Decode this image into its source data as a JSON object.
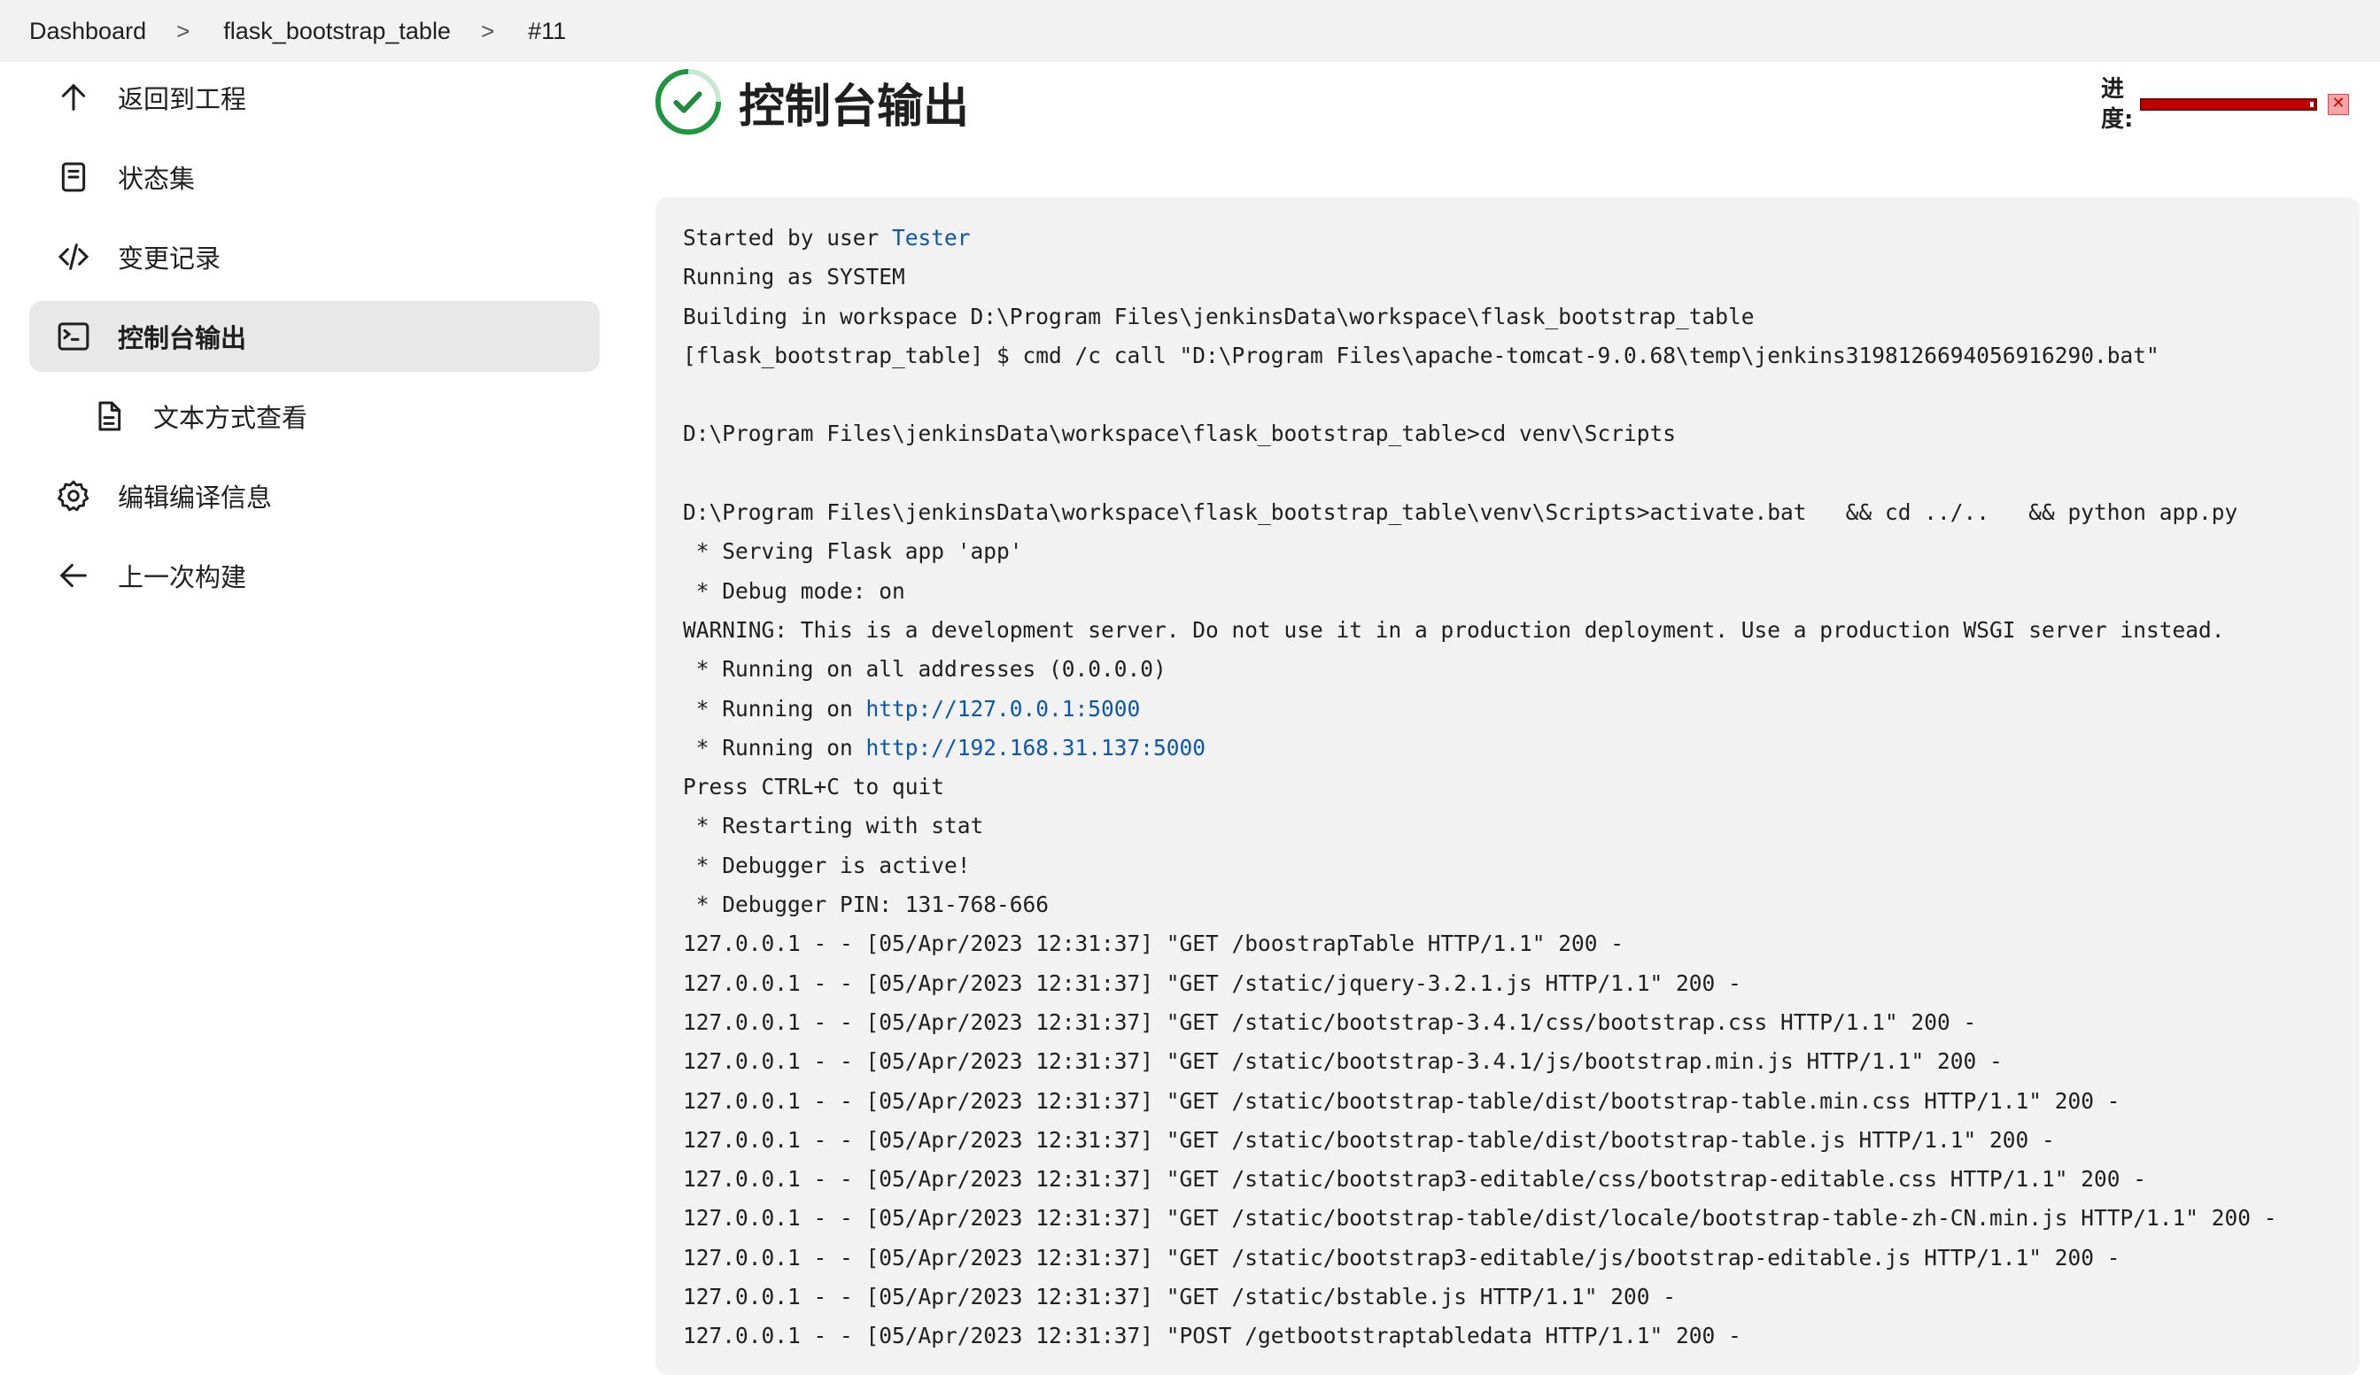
{
  "breadcrumb": [
    "Dashboard",
    "flask_bootstrap_table",
    "#11"
  ],
  "sidebar": {
    "items": [
      {
        "label": "返回到工程",
        "icon": "arrow-up-icon"
      },
      {
        "label": "状态集",
        "icon": "notepad-icon"
      },
      {
        "label": "变更记录",
        "icon": "code-icon"
      },
      {
        "label": "控制台输出",
        "icon": "terminal-icon",
        "active": true
      },
      {
        "label": "文本方式查看",
        "icon": "document-icon",
        "sub": true
      },
      {
        "label": "编辑编译信息",
        "icon": "gear-icon"
      },
      {
        "label": "上一次构建",
        "icon": "arrow-left-icon"
      }
    ]
  },
  "page": {
    "title": "控制台输出",
    "status_icon": "success-check-icon"
  },
  "progress": {
    "label": "进度:",
    "label_line1": "进",
    "label_line2": "度:",
    "value": 0.97,
    "bar_color": "#c00000"
  },
  "console": {
    "lines": [
      {
        "t": "Started by user ",
        "link": "Tester"
      },
      {
        "t": "Running as SYSTEM"
      },
      {
        "t": "Building in workspace D:\\Program Files\\jenkinsData\\workspace\\flask_bootstrap_table"
      },
      {
        "t": "[flask_bootstrap_table] $ cmd /c call \"D:\\Program Files\\apache-tomcat-9.0.68\\temp\\jenkins3198126694056916290.bat\""
      },
      {
        "t": ""
      },
      {
        "t": "D:\\Program Files\\jenkinsData\\workspace\\flask_bootstrap_table>cd venv\\Scripts"
      },
      {
        "t": ""
      },
      {
        "t": "D:\\Program Files\\jenkinsData\\workspace\\flask_bootstrap_table\\venv\\Scripts>activate.bat   && cd ../..   && python app.py"
      },
      {
        "t": " * Serving Flask app 'app'"
      },
      {
        "t": " * Debug mode: on"
      },
      {
        "t": "WARNING: This is a development server. Do not use it in a production deployment. Use a production WSGI server instead."
      },
      {
        "t": " * Running on all addresses (0.0.0.0)"
      },
      {
        "t": " * Running on ",
        "link": "http://127.0.0.1:5000"
      },
      {
        "t": " * Running on ",
        "link": "http://192.168.31.137:5000"
      },
      {
        "t": "Press CTRL+C to quit"
      },
      {
        "t": " * Restarting with stat"
      },
      {
        "t": " * Debugger is active!"
      },
      {
        "t": " * Debugger PIN: 131-768-666"
      },
      {
        "t": "127.0.0.1 - - [05/Apr/2023 12:31:37] \"GET /boostrapTable HTTP/1.1\" 200 -"
      },
      {
        "t": "127.0.0.1 - - [05/Apr/2023 12:31:37] \"GET /static/jquery-3.2.1.js HTTP/1.1\" 200 -"
      },
      {
        "t": "127.0.0.1 - - [05/Apr/2023 12:31:37] \"GET /static/bootstrap-3.4.1/css/bootstrap.css HTTP/1.1\" 200 -"
      },
      {
        "t": "127.0.0.1 - - [05/Apr/2023 12:31:37] \"GET /static/bootstrap-3.4.1/js/bootstrap.min.js HTTP/1.1\" 200 -"
      },
      {
        "t": "127.0.0.1 - - [05/Apr/2023 12:31:37] \"GET /static/bootstrap-table/dist/bootstrap-table.min.css HTTP/1.1\" 200 -"
      },
      {
        "t": "127.0.0.1 - - [05/Apr/2023 12:31:37] \"GET /static/bootstrap-table/dist/bootstrap-table.js HTTP/1.1\" 200 -"
      },
      {
        "t": "127.0.0.1 - - [05/Apr/2023 12:31:37] \"GET /static/bootstrap3-editable/css/bootstrap-editable.css HTTP/1.1\" 200 -"
      },
      {
        "t": "127.0.0.1 - - [05/Apr/2023 12:31:37] \"GET /static/bootstrap-table/dist/locale/bootstrap-table-zh-CN.min.js HTTP/1.1\" 200 -"
      },
      {
        "t": "127.0.0.1 - - [05/Apr/2023 12:31:37] \"GET /static/bootstrap3-editable/js/bootstrap-editable.js HTTP/1.1\" 200 -"
      },
      {
        "t": "127.0.0.1 - - [05/Apr/2023 12:31:37] \"GET /static/bstable.js HTTP/1.1\" 200 -"
      },
      {
        "t": "127.0.0.1 - - [05/Apr/2023 12:31:37] \"POST /getbootstraptabledata HTTP/1.1\" 200 -"
      }
    ]
  }
}
